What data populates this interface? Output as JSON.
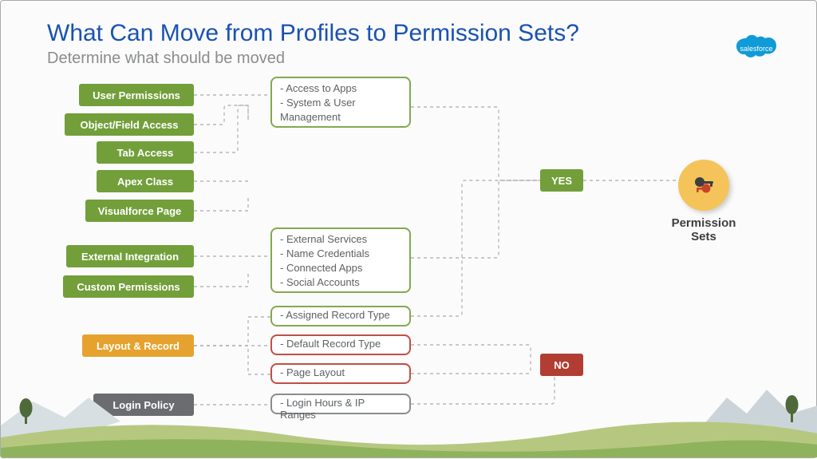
{
  "title": "What Can Move from Profiles to Permission Sets?",
  "subtitle": "Determine what should be moved",
  "logo_text": "salesforce",
  "pills": {
    "user_permissions": "User Permissions",
    "object_field_access": "Object/Field Access",
    "tab_access": "Tab Access",
    "apex_class": "Apex Class",
    "visualforce_page": "Visualforce Page",
    "external_integration": "External Integration",
    "custom_permissions": "Custom Permissions",
    "layout_record": "Layout & Record",
    "login_policy": "Login Policy"
  },
  "detail_user_permissions": [
    "- Access to Apps",
    "- System & User",
    "  Management"
  ],
  "detail_external": [
    "-  External Services",
    "-  Name Credentials",
    "-  Connected Apps",
    "-  Social Accounts"
  ],
  "detail_assigned_record": "- Assigned Record Type",
  "detail_default_record": "- Default Record Type",
  "detail_page_layout": "- Page Layout",
  "detail_login_policy": "- Login Hours & IP Ranges",
  "yes": "YES",
  "no": "NO",
  "permission_sets": "Permission Sets",
  "colors": {
    "green": "#729f3a",
    "yellow": "#e6a22e",
    "gray": "#6b6c70",
    "red": "#b13d33",
    "title": "#1a52b1"
  }
}
